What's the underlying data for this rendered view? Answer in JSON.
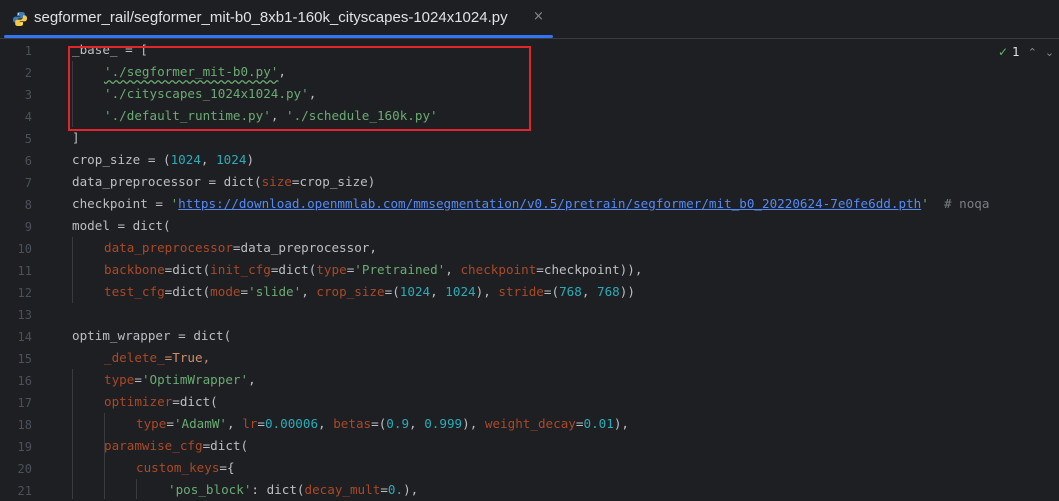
{
  "tab": {
    "title": "segformer_rail/segformer_mit-b0_8xb1-160k_cityscapes-1024x1024.py",
    "close": "×",
    "icon": "python-file-icon",
    "accent_color": "#3574f0"
  },
  "inspection": {
    "check": "✓",
    "count": "1",
    "up": "⌃",
    "down": "⌄"
  },
  "line_numbers": [
    "1",
    "2",
    "3",
    "4",
    "5",
    "6",
    "7",
    "8",
    "9",
    "10",
    "11",
    "12",
    "13",
    "14",
    "15",
    "16",
    "17",
    "18",
    "19",
    "20",
    "21"
  ],
  "code": {
    "l1": {
      "a": "_base_ = ["
    },
    "l2": {
      "s": "'./segformer_mit-b0.py'",
      "t": ","
    },
    "l3": {
      "s": "'./cityscapes_1024x1024.py'",
      "t": ","
    },
    "l4": {
      "s1": "'./default_runtime.py'",
      "t1": ", ",
      "s2": "'./schedule_160k.py'"
    },
    "l5": {
      "a": "]"
    },
    "l6": {
      "a": "crop_size = (",
      "n1": "1024",
      "b": ", ",
      "n2": "1024",
      "c": ")"
    },
    "l7": {
      "a": "data_preprocessor = dict(",
      "p": "size",
      "b": "=crop_size)"
    },
    "l8": {
      "a": "checkpoint = ",
      "q1": "'",
      "url": "https://download.openmmlab.com/mmsegmentation/v0.5/pretrain/segformer/mit_b0_20220624-7e0fe6dd.pth",
      "q2": "'",
      "comment": "  # noqa"
    },
    "l9": {
      "a": "model = dict("
    },
    "l10": {
      "p": "data_preprocessor",
      "b": "=data_preprocessor,"
    },
    "l11": {
      "p1": "backbone",
      "b1": "=dict(",
      "p2": "init_cfg",
      "b2": "=dict(",
      "p3": "type",
      "b3": "=",
      "s": "'Pretrained'",
      "b4": ", ",
      "p4": "checkpoint",
      "b5": "=checkpoint)),"
    },
    "l12": {
      "p1": "test_cfg",
      "b1": "=dict(",
      "p2": "mode",
      "b2": "=",
      "s": "'slide'",
      "b3": ", ",
      "p3": "crop_size",
      "b4": "=(",
      "n1": "1024",
      "b5": ", ",
      "n2": "1024",
      "b6": "), ",
      "p4": "stride",
      "b7": "=(",
      "n3": "768",
      "b8": ", ",
      "n4": "768",
      "b9": "))"
    },
    "l14": {
      "a": "optim_wrapper = dict("
    },
    "l15": {
      "p": "_delete_",
      "b": "=True,"
    },
    "l16": {
      "p": "type",
      "b": "=",
      "s": "'OptimWrapper'",
      "c": ","
    },
    "l17": {
      "p": "optimizer",
      "b": "=dict("
    },
    "l18": {
      "p1": "type",
      "b1": "=",
      "s": "'AdamW'",
      "b2": ", ",
      "p2": "lr",
      "b3": "=",
      "n1": "0.00006",
      "b4": ", ",
      "p3": "betas",
      "b5": "=(",
      "n2": "0.9",
      "b6": ", ",
      "n3": "0.999",
      "b7": "), ",
      "p4": "weight_decay",
      "b8": "=",
      "n4": "0.01",
      "b9": "),"
    },
    "l19": {
      "p": "paramwise_cfg",
      "b": "=dict("
    },
    "l20": {
      "p": "custom_keys",
      "b": "={"
    },
    "l21": {
      "s": "'pos_block'",
      "b1": ": dict(",
      "p": "decay_mult",
      "b2": "=",
      "n": "0.",
      "b3": "),"
    }
  },
  "colors": {
    "background": "#1e1f22",
    "keyword": "#cf8e6d",
    "string": "#6aab73",
    "number": "#2aacb8",
    "param": "#aa4926",
    "link": "#548af7",
    "highlight_box": "#e0262a"
  }
}
